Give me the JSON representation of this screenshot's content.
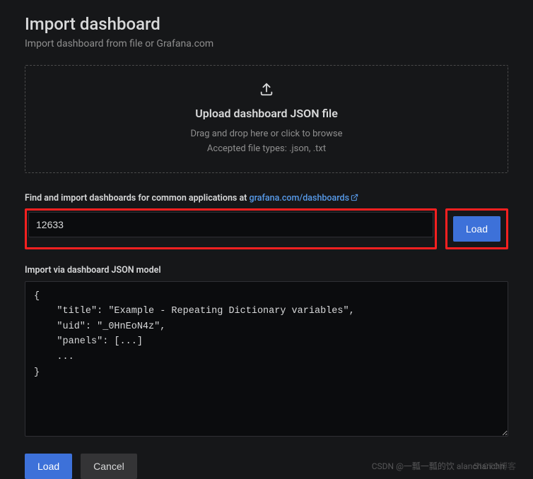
{
  "page": {
    "title": "Import dashboard",
    "subtitle": "Import dashboard from file or Grafana.com"
  },
  "dropzone": {
    "title": "Upload dashboard JSON file",
    "line1": "Drag and drop here or click to browse",
    "line2": "Accepted file types: .json, .txt"
  },
  "import_by_id": {
    "label_prefix": "Find and import dashboards for common applications at ",
    "link_text": "grafana.com/dashboards",
    "value": "12633",
    "load_label": "Load"
  },
  "json_model": {
    "label": "Import via dashboard JSON model",
    "value": "{\n    \"title\": \"Example - Repeating Dictionary variables\",\n    \"uid\": \"_0HnEoN4z\",\n    \"panels\": [...]\n    ...\n}"
  },
  "actions": {
    "load": "Load",
    "cancel": "Cancel"
  },
  "watermark": {
    "a": "CSDN @一瓢一瓢的饮  alanchanchn",
    "b": "51CTO博客"
  }
}
